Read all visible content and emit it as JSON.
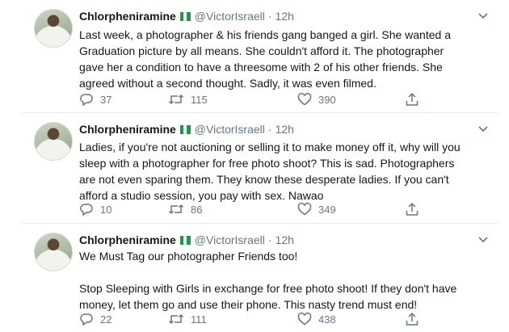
{
  "tweets": [
    {
      "name": "Chlorpheniramine",
      "handle": "@VictorIsraell",
      "time": "12h",
      "text": "Last week, a photographer & his friends gang banged a girl. She wanted a Graduation picture by all means. She couldn't afford it. The photographer gave her a condition to have a threesome with 2 of his other friends. She agreed without a second thought. Sadly, it was even filmed.",
      "replies": "37",
      "retweets": "115",
      "likes": "390"
    },
    {
      "name": "Chlorpheniramine",
      "handle": "@VictorIsraell",
      "time": "12h",
      "text": "Ladies, if you're not auctioning or selling it to make money off it, why will you sleep with a photographer for free photo shoot? This is sad. Photographers are not even sparing them. They know these desperate ladies. If you can't afford a studio session,  you pay with sex. Nawao",
      "replies": "10",
      "retweets": "86",
      "likes": "349"
    },
    {
      "name": "Chlorpheniramine",
      "handle": "@VictorIsraell",
      "time": "12h",
      "text": "We Must Tag our photographer Friends too!\n\nStop Sleeping with Girls in exchange for free photo shoot! If they don't have money, let them go and use their phone. This nasty trend must end!",
      "replies": "22",
      "retweets": "111",
      "likes": "438"
    }
  ],
  "icons": {
    "reply": "reply-icon",
    "retweet": "retweet-icon",
    "like": "heart-icon",
    "share": "share-icon",
    "more": "chevron-down-icon",
    "flag": "nigeria-flag-icon"
  },
  "colors": {
    "text": "#14171a",
    "muted": "#657786",
    "divider": "#e6ecf0",
    "flag_green": "#1a9a4a"
  }
}
